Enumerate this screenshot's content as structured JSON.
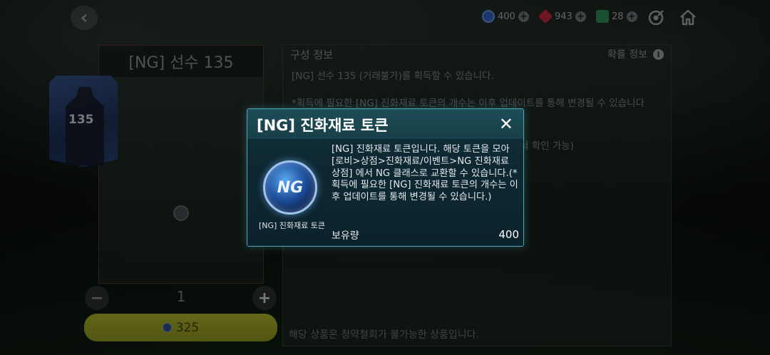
{
  "topbar": {
    "back_glyph": "‹",
    "currencies": [
      {
        "name": "currency-1",
        "value": "400",
        "color": "#2f5fb8"
      },
      {
        "name": "currency-2",
        "value": "943",
        "color": "#c0283a"
      },
      {
        "name": "currency-3",
        "value": "28",
        "color": "#2e8a55"
      }
    ],
    "icons": [
      "target-icon",
      "home-icon"
    ]
  },
  "card": {
    "title": "[NG] 선수 135",
    "number": "135",
    "quantity": "1",
    "minus": "−",
    "plus": "+",
    "price": "325"
  },
  "info": {
    "header": "구성 정보",
    "probability_label": "확률 정보",
    "info_glyph": "i",
    "line1": "[NG] 선수 135 (거래불가)를 획득할 수 있습니다.",
    "line2": "*획득에 필요한 [NG] 진화재료 토큰의 개수는 이후 업데이트를 통해 변경될 수 있습니다",
    "line3": "서 확인 가능)",
    "footer": "해당 상품은 청약철회가 불가능한 상품입니다."
  },
  "modal": {
    "title": "[NG] 진화재료 토큰",
    "close_glyph": "✕",
    "token_text": "NG",
    "token_label": "[NG] 진화재료 토큰",
    "description": "[NG] 진화재료 토큰입니다. 해당 토큰을 모아 [로비>상점>진화재료/이벤트>NG 진화재료 상점] 에서 NG 클래스로 교환할 수 있습니다.(*획득에 필요한 [NG] 진화재료 토큰의 개수는 이후 업데이트를 통해 변경될 수 있습니다.)",
    "hold_label": "보유량",
    "hold_value": "400"
  }
}
